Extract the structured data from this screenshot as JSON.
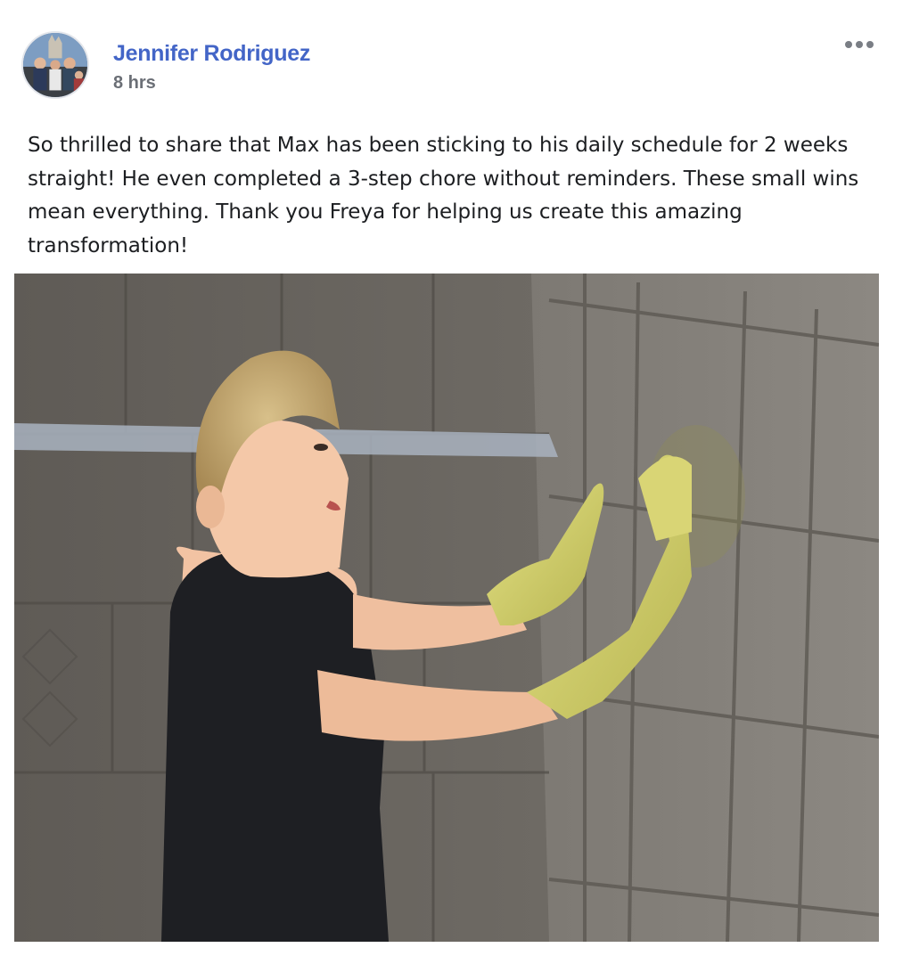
{
  "post": {
    "author_name": "Jennifer Rodriguez",
    "timestamp": "8 hrs",
    "more_icon": "more-horizontal-icon",
    "text": "So thrilled to share that Max has been sticking to his daily schedule for 2 weeks straight! He even completed a 3-step chore without reminders. These small wins mean everything. Thank you Freya for helping us create this amazing transformation!"
  },
  "colors": {
    "author_link": "#4365c7",
    "timestamp": "#6b6f76",
    "text": "#1c1e21"
  }
}
